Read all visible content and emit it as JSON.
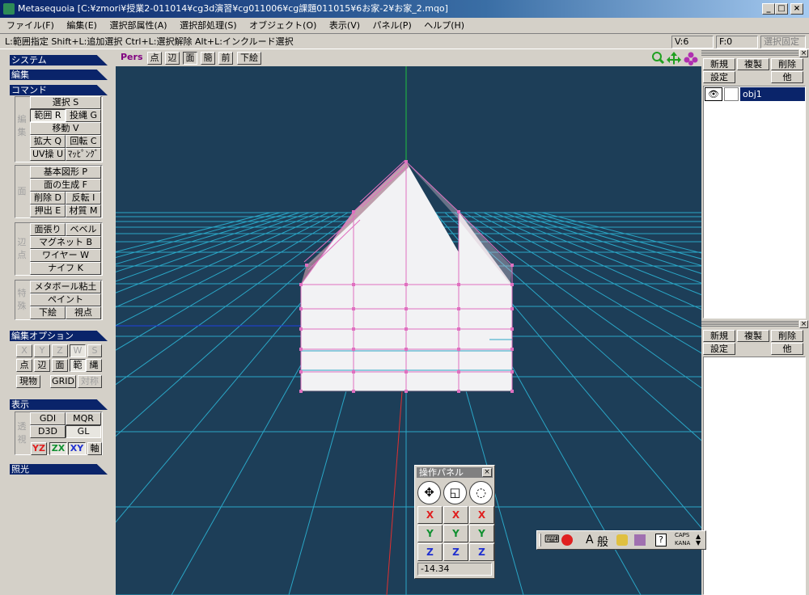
{
  "window": {
    "title": "Metasequoia [C:¥zmori¥授業2-011014¥cg3d演習¥cg011006¥cg課題011015¥6お家-2¥お家_2.mqo]",
    "minimize": "_",
    "maximize": "□",
    "close": "×"
  },
  "menu": [
    "ファイル(F)",
    "編集(E)",
    "選択部属性(A)",
    "選択部処理(S)",
    "オブジェクト(O)",
    "表示(V)",
    "パネル(P)",
    "ヘルプ(H)"
  ],
  "hint": "L:範囲指定  Shift+L:追加選択  Ctrl+L:選択解除  Alt+L:インクルード選択",
  "status": {
    "vertices": "V:6",
    "faces": "F:0",
    "fix": "選択固定"
  },
  "sections": {
    "system": "システム",
    "edit": "編集",
    "command": "コマンド",
    "editopt": "編集オプション",
    "display": "表示",
    "lighting": "照光"
  },
  "groups": {
    "henshu": "編集",
    "men": "面",
    "henten": "辺点",
    "tokushu": "特殊",
    "toushi": "透視"
  },
  "commands": {
    "select": "選択 S",
    "range": "範囲 R",
    "lasso": "投縄 G",
    "move": "移動 V",
    "scale": "拡大 Q",
    "rotate": "回転 C",
    "uv": "UV操 U",
    "mapping": "ﾏｯﾋﾟﾝｸﾞ",
    "primitive": "基本図形 P",
    "genface": "面の生成 F",
    "delete": "削除 D",
    "invert": "反転 I",
    "extrude": "押出 E",
    "material": "材質 M",
    "stretch": "面張り",
    "bevel": "ベベル",
    "magnet": "マグネット B",
    "wire": "ワイヤー W",
    "knife": "ナイフ K",
    "metaball": "メタボール粘土",
    "paint": "ペイント",
    "underlay": "下絵",
    "view": "視点"
  },
  "editopt": {
    "x": "X",
    "y": "Y",
    "z": "Z",
    "w": "W",
    "s": "S",
    "pt": "点",
    "edge": "辺",
    "face": "面",
    "range": "範",
    "lasso": "縄",
    "current": "現物",
    "grid": "GRID",
    "sym": "対称"
  },
  "display": {
    "gdi": "GDI",
    "mqr": "MQR",
    "d3d": "D3D",
    "gl": "GL",
    "yz": "YZ",
    "zx": "ZX",
    "xy": "XY",
    "axis": "軸"
  },
  "viewtool": {
    "mode": "Pers",
    "pt": "点",
    "edge": "辺",
    "face": "面",
    "simple": "簡",
    "front": "前",
    "underlay": "下絵"
  },
  "objpanel": {
    "new": "新規",
    "copy": "複製",
    "delete": "削除",
    "settings": "設定",
    "other": "他",
    "object": "obj1",
    "close": "×"
  },
  "matpanel": {
    "new": "新規",
    "copy": "複製",
    "delete": "削除",
    "settings": "設定",
    "other": "他",
    "close": "×"
  },
  "oppanel": {
    "title": "操作パネル",
    "close": "×",
    "x": "X",
    "y": "Y",
    "z": "Z",
    "value": "-14.34"
  },
  "ime": {
    "a": "A",
    "han": "般",
    "caps": "CAPS",
    "kana": "KANA"
  },
  "colors": {
    "viewport": "#1d3e58",
    "grid": "#2aa6c6",
    "accent": "#0a246a",
    "house_edge": "#e070c0",
    "axis_x": "#e03030",
    "axis_y": "#20c040",
    "axis_z": "#2040e0"
  }
}
